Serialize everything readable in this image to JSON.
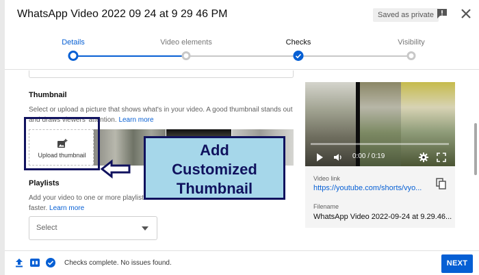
{
  "header": {
    "title": "WhatsApp Video 2022 09 24 at 9 29 46 PM",
    "saved_chip": "Saved as private",
    "feedback_icon": "feedback-icon",
    "close_icon": "close-icon"
  },
  "stepper": {
    "steps": [
      {
        "label": "Details",
        "state": "current"
      },
      {
        "label": "Video elements",
        "state": "pending"
      },
      {
        "label": "Checks",
        "state": "done"
      },
      {
        "label": "Visibility",
        "state": "pending"
      }
    ]
  },
  "thumbnail": {
    "title": "Thumbnail",
    "description": "Select or upload a picture that shows what's in your video. A good thumbnail stands out and draws viewers' attention.",
    "learn_more": "Learn more",
    "upload_label": "Upload thumbnail"
  },
  "annotation": {
    "text": "Add\nCustomized\nThumbnail"
  },
  "playlists": {
    "title": "Playlists",
    "description_line1": "Add your video to one or more playlists.",
    "description_line2": "faster.",
    "learn_more": "Learn more",
    "select_value": "Select"
  },
  "video": {
    "time": "0:00 / 0:19",
    "progress": 0,
    "link_label": "Video link",
    "link": "https://youtube.com/shorts/vyo...",
    "filename_label": "Filename",
    "filename": "WhatsApp Video 2022-09-24 at 9.29.46..."
  },
  "footer": {
    "status": "Checks complete. No issues found.",
    "next_label": "NEXT"
  },
  "colors": {
    "accent": "#065fd4",
    "annotation_fill": "#a6d7ea",
    "annotation_border": "#10125e"
  }
}
